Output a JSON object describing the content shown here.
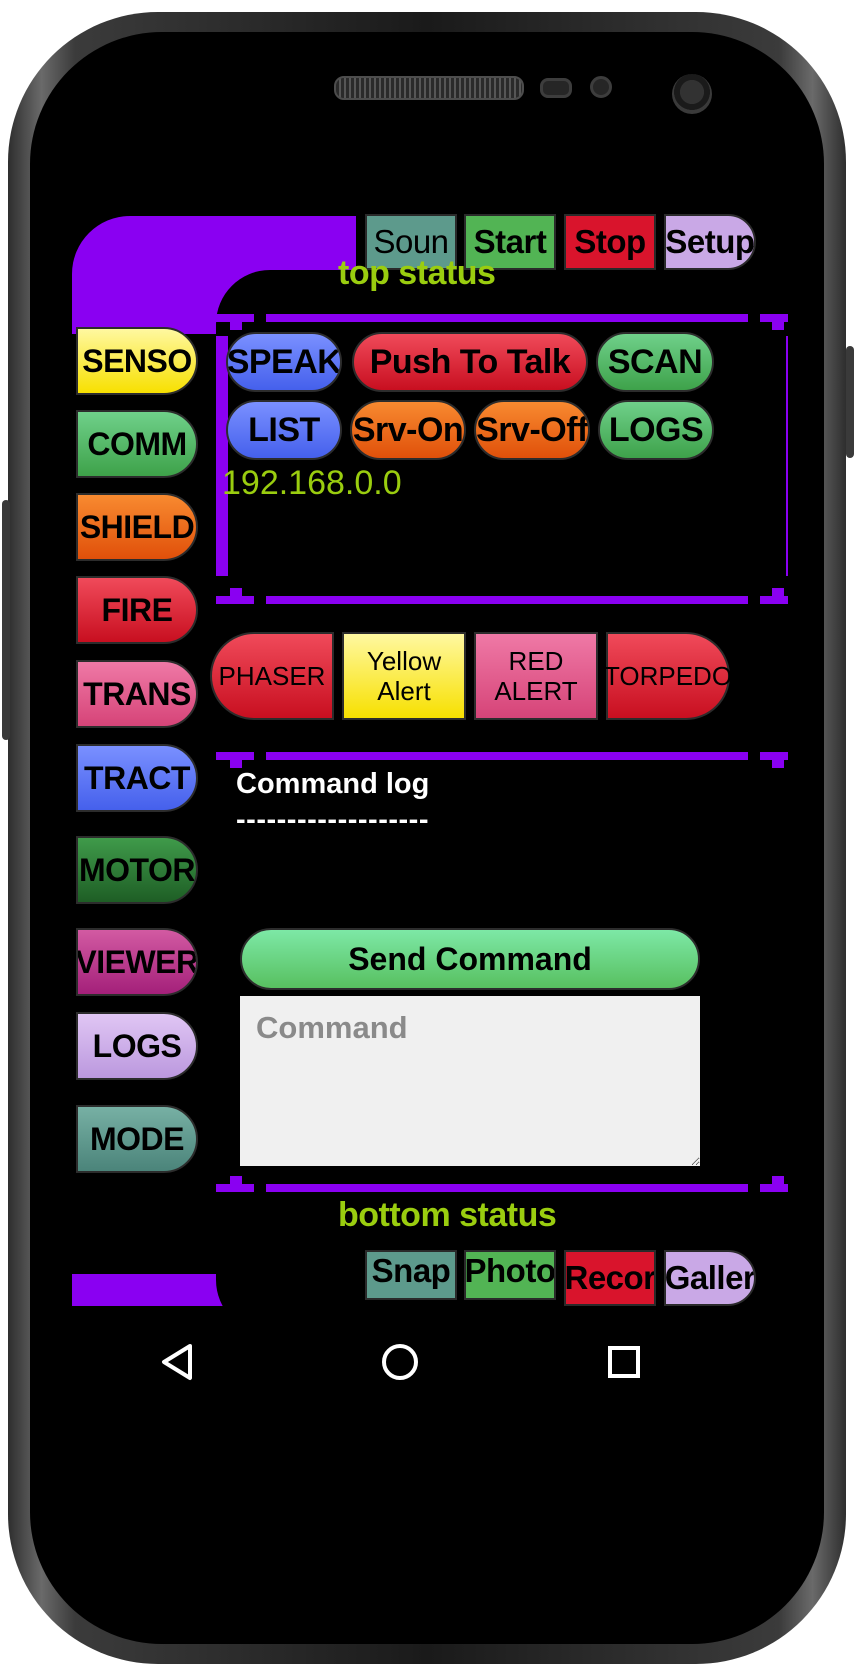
{
  "top_buttons": [
    {
      "label": "Soun",
      "color": "#5d9a8c"
    },
    {
      "label": "Start",
      "color": "#52b454"
    },
    {
      "label": "Stop",
      "color": "#d9142c"
    },
    {
      "label": "Setup",
      "color": "#c9a8e6"
    }
  ],
  "top_status": "top status",
  "side_menu": [
    {
      "label": "SENSO",
      "color": "#fff12a"
    },
    {
      "label": "COMM",
      "color": "#50b858"
    },
    {
      "label": "SHIELD",
      "color": "#ee6212"
    },
    {
      "label": "FIRE",
      "color": "#e31732"
    },
    {
      "label": "TRANS",
      "color": "#e2568a"
    },
    {
      "label": "TRACT",
      "color": "#5a72f2"
    },
    {
      "label": "MOTOR",
      "color": "#2c7a34"
    },
    {
      "label": "VIEWER",
      "color": "#c0378c"
    },
    {
      "label": "LOGS",
      "color": "#cfaee8"
    },
    {
      "label": "MODE",
      "color": "#5f9c90"
    }
  ],
  "panel_buttons": {
    "speak": "SPEAK",
    "push_to_talk": "Push To Talk",
    "scan": "SCAN",
    "list": "LIST",
    "srv_on": "Srv-On",
    "srv_off": "Srv-Off",
    "logs": "LOGS"
  },
  "ip_address": "192.168.0.0",
  "alert_buttons": {
    "phaser": "PHASER",
    "yellow_alert": "Yellow Alert",
    "red_alert": "RED ALERT",
    "torpedo": "TORPEDO"
  },
  "command_log": {
    "title": "Command log",
    "separator": "-------------------"
  },
  "send_command_label": "Send Command",
  "command_input": {
    "placeholder": "Command",
    "value": ""
  },
  "bottom_status": "bottom status",
  "bottom_buttons": [
    {
      "label": "Snap",
      "color": "#5d9a8c"
    },
    {
      "label": "Photo",
      "color": "#52b454"
    },
    {
      "label": "Recor",
      "color": "#d9142c"
    },
    {
      "label": "Galler",
      "color": "#c9a8e6"
    }
  ],
  "nav_icons": [
    "back-icon",
    "home-icon",
    "recents-icon"
  ],
  "accent_color": "#8a00f2",
  "status_color": "#9acd0f"
}
